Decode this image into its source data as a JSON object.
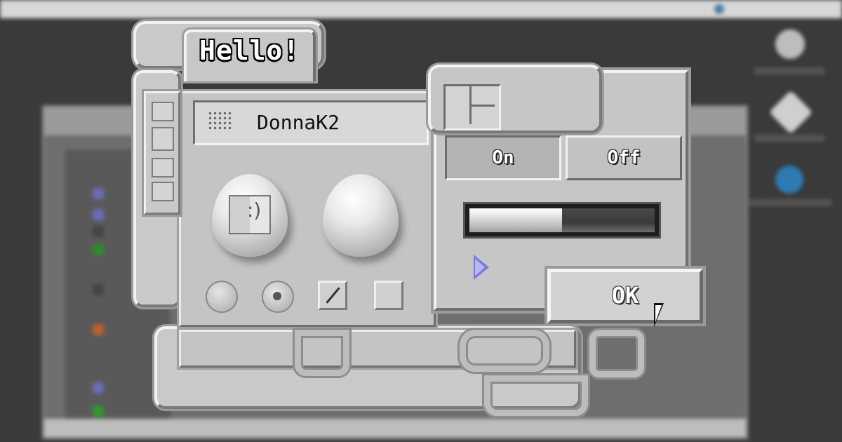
{
  "hello": {
    "title": "Hello!"
  },
  "user_panel": {
    "name": "DonnaK2"
  },
  "toggle": {
    "on_label": "On",
    "off_label": "Off",
    "selected": "On"
  },
  "progress": {
    "value": 0.5
  },
  "dialog": {
    "ok_label": "OK"
  },
  "controls": {
    "radios": [
      {
        "checked": false
      },
      {
        "checked": true
      }
    ],
    "checkboxes": [
      {
        "checked": true
      },
      {
        "checked": false
      }
    ]
  },
  "icons": {
    "finder": "finder-face-icon",
    "egg": "egg-icon",
    "layout": "window-layout-icon",
    "disclosure": "disclosure-triangle-icon",
    "cursor": "mouse-pointer-icon",
    "grid": "drag-grip-icon"
  },
  "colors": {
    "chrome": "#c6c6c6",
    "highlight": "#f2f2f2",
    "shadow": "#6f6f6f",
    "disclosure": "#7c7cd8",
    "desktop": "#3a3a3a"
  }
}
